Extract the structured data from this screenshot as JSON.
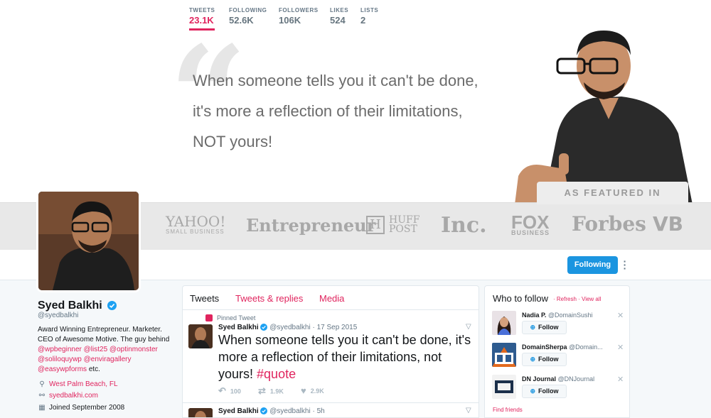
{
  "banner": {
    "quote_line1": "When someone tells you it can't be done,",
    "quote_line2": "it's more a reflection of their limitations,",
    "quote_line3": "NOT yours!",
    "featured_label": "AS FEATURED IN",
    "logos": {
      "yahoo": "YAHOO!",
      "yahoo_sub": "SMALL BUSINESS",
      "entrepreneur": "Entrepreneur",
      "huffpost_box": "H",
      "huffpost_line1": "HUFF",
      "huffpost_line2": "POST",
      "inc": "Inc.",
      "fox": "FOX",
      "fox_sub": "BUSINESS",
      "forbes": "Forbes",
      "vb": "VB"
    }
  },
  "nav": {
    "stats": [
      {
        "label": "TWEETS",
        "value": "23.1K"
      },
      {
        "label": "FOLLOWING",
        "value": "52.6K"
      },
      {
        "label": "FOLLOWERS",
        "value": "106K"
      },
      {
        "label": "LIKES",
        "value": "524"
      },
      {
        "label": "LISTS",
        "value": "2"
      }
    ],
    "following_button": "Following",
    "more_icon": "vertical-dots-icon"
  },
  "profile": {
    "name": "Syed Balkhi",
    "handle": "@syedbalkhi",
    "bio_1": "Award Winning Entrepreneur. Marketer. CEO of Awesome Motive. The guy behind ",
    "bio_links": {
      "wpbeginner": "@wpbeginner",
      "list25": "@list25",
      "optinmonster": "@optinmonster",
      "soliloquywp": "@soliloquywp",
      "enviragallery": "@enviragallery",
      "easywpforms": "@easywpforms"
    },
    "bio_end": " etc.",
    "location": "West Palm Beach, FL",
    "website": "syedbalkhi.com",
    "joined": "Joined September 2008",
    "accent_color": "#e0245e"
  },
  "timeline": {
    "tabs": [
      "Tweets",
      "Tweets & replies",
      "Media"
    ],
    "pinned_label": "Pinned Tweet",
    "tweet1": {
      "name": "Syed Balkhi",
      "handle": "@syedbalkhi",
      "date": "17 Sep 2015",
      "text": "When someone tells you it can't be done, it's more a reflection of their limitations, not yours! ",
      "hashtag": "#quote",
      "replies": "100",
      "retweets": "1.9K",
      "likes": "2.9K"
    },
    "tweet2": {
      "name": "Syed Balkhi",
      "handle": "@syedbalkhi",
      "date": "5h"
    }
  },
  "who_to_follow": {
    "title": "Who to follow",
    "refresh": "Refresh",
    "view_all": "View all",
    "follow_label": "Follow",
    "find_friends": "Find friends",
    "suggestions": [
      {
        "name": "Nadia P.",
        "handle": "@DomainSushi"
      },
      {
        "name": "DomainSherpa",
        "handle": "@Domain..."
      },
      {
        "name": "DN Journal",
        "handle": "@DNJournal"
      }
    ]
  }
}
